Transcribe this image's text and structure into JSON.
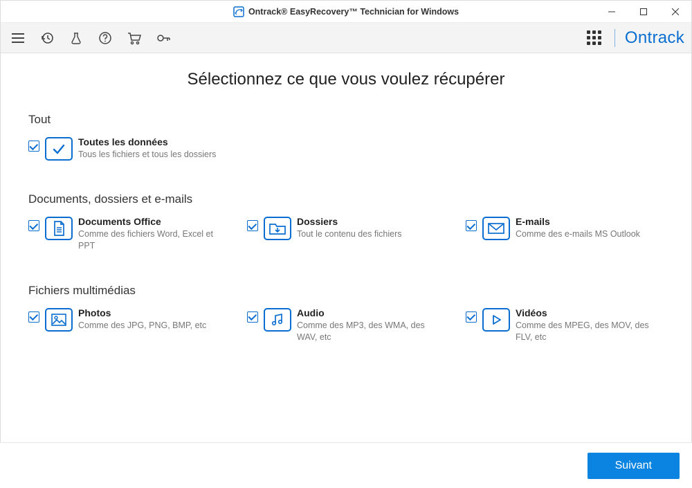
{
  "window": {
    "title": "Ontrack® EasyRecovery™ Technician for Windows"
  },
  "brand": "Ontrack",
  "page_title": "Sélectionnez ce que vous voulez récupérer",
  "sections": {
    "all": {
      "heading": "Tout",
      "option_label": "Toutes les données",
      "option_desc": "Tous les fichiers et tous les dossiers"
    },
    "docs": {
      "heading": "Documents, dossiers et e-mails",
      "office_label": "Documents Office",
      "office_desc": "Comme des fichiers Word, Excel et PPT",
      "folders_label": "Dossiers",
      "folders_desc": "Tout le contenu des fichiers",
      "emails_label": "E-mails",
      "emails_desc": "Comme des e-mails MS Outlook"
    },
    "media": {
      "heading": "Fichiers multimédias",
      "photos_label": "Photos",
      "photos_desc": "Comme des JPG, PNG, BMP, etc",
      "audio_label": "Audio",
      "audio_desc": "Comme des MP3, des WMA, des WAV, etc",
      "videos_label": "Vidéos",
      "videos_desc": "Comme des MPEG, des MOV, des FLV, etc"
    }
  },
  "footer": {
    "next": "Suivant"
  }
}
